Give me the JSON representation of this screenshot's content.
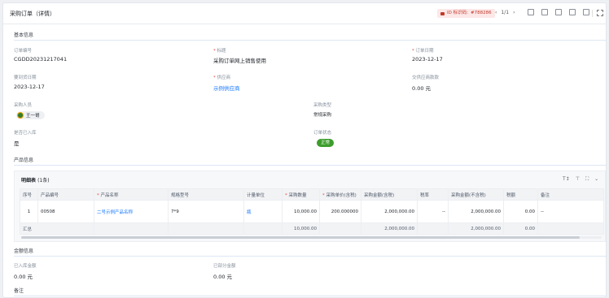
{
  "header": {
    "title": "采购订单（详情）",
    "id_label": "ID 标识码:",
    "id_value": "#788286",
    "pager": "1/1"
  },
  "basic": {
    "section_title": "基本信息",
    "fields": {
      "order_no_label": "订单编号",
      "order_no": "CGDD20231217041",
      "subject_label": "标题",
      "subject": "采购订单网上销售使用",
      "order_date_label": "订单日期",
      "order_date": "2023-12-17",
      "due_date_label": "要到货日期",
      "due_date": "2023-12-17",
      "supplier_label": "供应商",
      "supplier": "示例供应商",
      "paid_label": "交供应商款款",
      "paid": "0.00 元",
      "purchaser_label": "采购人员",
      "purchaser": "王一哥",
      "purchase_type_label": "采购类型",
      "purchase_type": "常规采购",
      "stocked_label": "是否已入库",
      "stocked": "是",
      "status_label": "订单状态",
      "status": "正常"
    }
  },
  "product": {
    "section_title": "产品信息",
    "table_title": "明细表",
    "table_count": "(1条)",
    "columns": [
      "序号",
      "产品编号",
      "产品名称",
      "规格型号",
      "计量单位",
      "采购数量",
      "采购单价(含税)",
      "采购金额(含税)",
      "税率",
      "采购金额(不含税)",
      "税额",
      "备注"
    ],
    "required_cols": [
      2,
      5,
      6
    ],
    "row": {
      "seq": "1",
      "code": "00508",
      "name": "二号示例产品名称",
      "spec": "7*9",
      "unit": "瓶",
      "qty": "10,000.00",
      "price": "200.000000",
      "amount": "2,000,000.00",
      "tax_rate": "--",
      "amount_ex": "2,000,000.00",
      "tax": "0.00",
      "note": "--"
    },
    "sum": {
      "label": "汇总",
      "qty": "10,000.00",
      "amount": "2,000,000.00",
      "amount_ex": "2,000,000.00",
      "tax": "0.00"
    }
  },
  "amount": {
    "section_title": "金额信息",
    "stocked_amount_label": "已入库金额",
    "stocked_amount": "0.00 元",
    "paid_amount_label": "已部分金额",
    "paid_amount": "0.00 元"
  },
  "remark": {
    "section_title": "备注"
  }
}
